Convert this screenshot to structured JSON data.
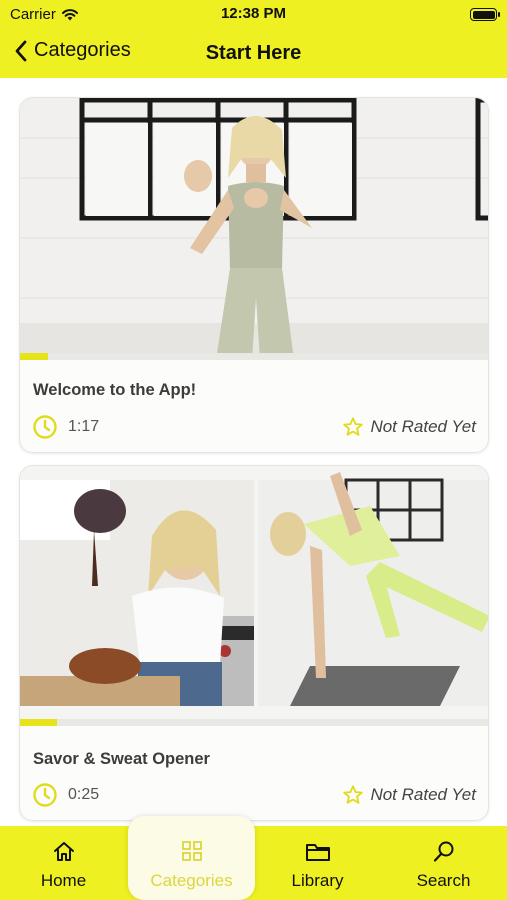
{
  "status_bar": {
    "carrier": "Carrier",
    "time": "12:38 PM"
  },
  "nav": {
    "back_label": "Categories",
    "title": "Start Here"
  },
  "cards": [
    {
      "title": "Welcome to the App!",
      "duration": "1:17",
      "rating": "Not Rated Yet",
      "progress": 0.06
    },
    {
      "title": "Savor & Sweat Opener",
      "duration": "0:25",
      "rating": "Not Rated Yet",
      "progress": 0.08
    }
  ],
  "tabs": [
    {
      "label": "Home",
      "icon": "home-icon"
    },
    {
      "label": "Categories",
      "icon": "grid-icon",
      "active": true
    },
    {
      "label": "Library",
      "icon": "folder-icon"
    },
    {
      "label": "Search",
      "icon": "search-icon"
    }
  ],
  "colors": {
    "accent": "#eef021",
    "progress": "#e6e31a",
    "active_tab_label": "#dcd73c"
  }
}
